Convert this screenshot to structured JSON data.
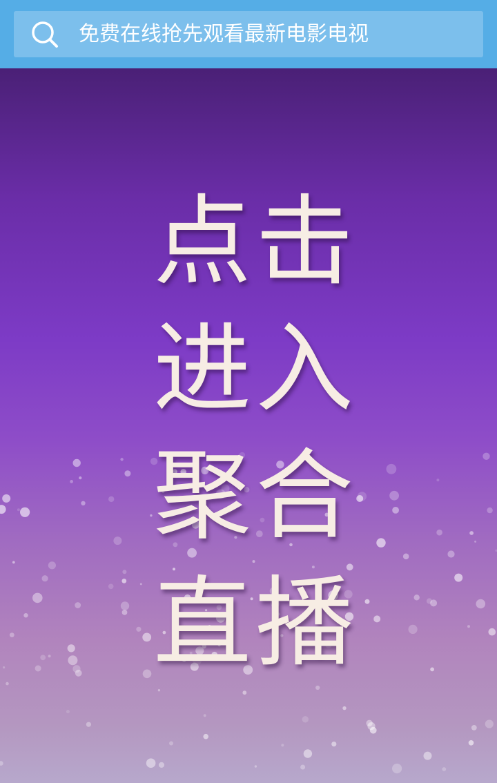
{
  "search": {
    "placeholder": "免费在线抢先观看最新电影电视",
    "icon": "search-icon"
  },
  "banner": {
    "lines": [
      "点击",
      "进入",
      "聚合",
      "直播"
    ],
    "text_color": "#f7ede4",
    "gradient_top": "#4a2076",
    "gradient_bottom": "#b7a8cc"
  },
  "colors": {
    "topbar": "#55ade6",
    "search_box": "#7cbfec"
  }
}
